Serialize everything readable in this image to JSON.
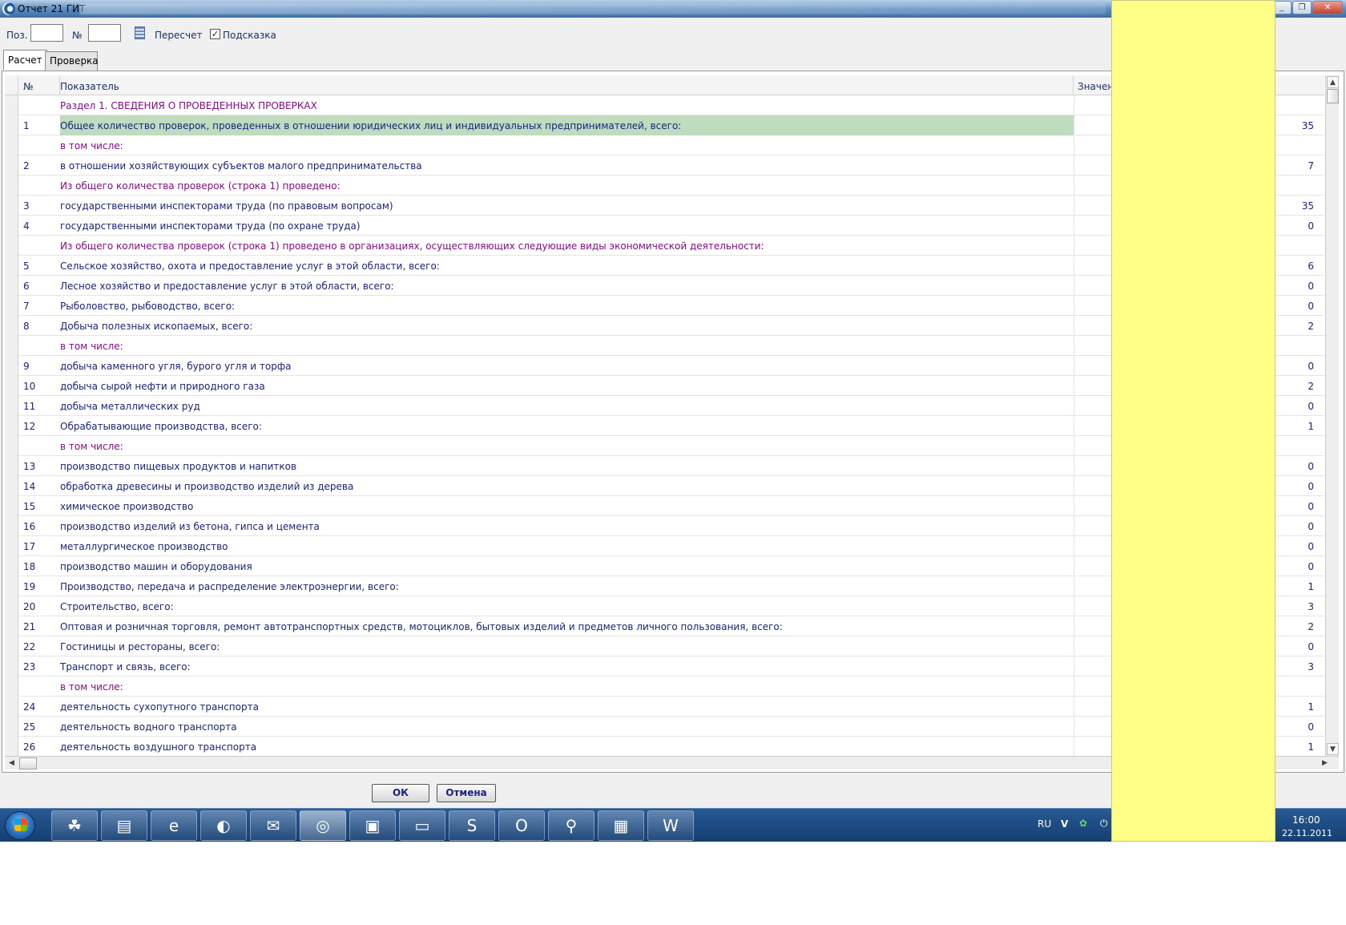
{
  "window": {
    "title": "Отчет 21 ГИТ",
    "controls": [
      "_",
      "❐",
      "✕"
    ]
  },
  "toolbar": {
    "pos_label": "Поз.",
    "pos_value": "",
    "num_label": "№",
    "num_value": "",
    "recalc_label": "Пересчет",
    "hint_label": "Подсказка",
    "hint_checked": true,
    "hint_check_glyph": "✓"
  },
  "tabs": [
    {
      "label": "Расчет",
      "active": true
    },
    {
      "label": "Проверка",
      "active": false
    }
  ],
  "grid": {
    "columns": {
      "num": "№",
      "indicator": "Показатель",
      "value": "Значени"
    },
    "rows": [
      {
        "num": "",
        "text": "Раздел 1. СВЕДЕНИЯ О ПРОВЕДЕННЫХ ПРОВЕРКАХ",
        "value": "",
        "section": true
      },
      {
        "num": "1",
        "text": "Общее количество проверок, проведенных в отношении юридических лиц и индивидуальных предпринимателей, всего:",
        "value": "35",
        "selected": true
      },
      {
        "num": "",
        "text": "в том числе:",
        "value": "",
        "section": true
      },
      {
        "num": "2",
        "text": "в отношении хозяйствующих субъектов малого предпринимательства",
        "value": "7"
      },
      {
        "num": "",
        "text": "Из общего количества проверок (строка 1) проведено:",
        "value": "",
        "section": true
      },
      {
        "num": "3",
        "text": "государственными инспекторами труда (по правовым вопросам)",
        "value": "35"
      },
      {
        "num": "4",
        "text": "государственными инспекторами труда (по охране труда)",
        "value": "0"
      },
      {
        "num": "",
        "text": "Из общего количества проверок (строка 1) проведено в организациях, осуществляющих следующие виды экономической деятельности:",
        "value": "",
        "section": true
      },
      {
        "num": "5",
        "text": "Сельское хозяйство, охота и предоставление услуг в этой области, всего:",
        "value": "6"
      },
      {
        "num": "6",
        "text": "Лесное хозяйство и предоставление услуг в этой области, всего:",
        "value": "0"
      },
      {
        "num": "7",
        "text": "Рыболовство, рыбоводство, всего:",
        "value": "0"
      },
      {
        "num": "8",
        "text": "Добыча полезных ископаемых, всего:",
        "value": "2"
      },
      {
        "num": "",
        "text": "в том числе:",
        "value": "",
        "section": true
      },
      {
        "num": "9",
        "text": "добыча каменного угля, бурого угля и торфа",
        "value": "0"
      },
      {
        "num": "10",
        "text": "добыча сырой нефти и природного газа",
        "value": "2"
      },
      {
        "num": "11",
        "text": "добыча металлических руд",
        "value": "0"
      },
      {
        "num": "12",
        "text": "Обрабатывающие производства, всего:",
        "value": "1"
      },
      {
        "num": "",
        "text": "в том числе:",
        "value": "",
        "section": true
      },
      {
        "num": "13",
        "text": "производство пищевых продуктов и напитков",
        "value": "0"
      },
      {
        "num": "14",
        "text": "обработка древесины и производство изделий из дерева",
        "value": "0"
      },
      {
        "num": "15",
        "text": "химическое производство",
        "value": "0"
      },
      {
        "num": "16",
        "text": "производство изделий из бетона, гипса и цемента",
        "value": "0"
      },
      {
        "num": "17",
        "text": "металлургическое производство",
        "value": "0"
      },
      {
        "num": "18",
        "text": "производство машин и оборудования",
        "value": "0"
      },
      {
        "num": "19",
        "text": "Производство, передача и распределение электроэнергии, всего:",
        "value": "1"
      },
      {
        "num": "20",
        "text": "Строительство, всего:",
        "value": "3"
      },
      {
        "num": "21",
        "text": "Оптовая и розничная торговля, ремонт автотранспортных средств, мотоциклов, бытовых изделий и предметов личного пользования, всего:",
        "value": "2"
      },
      {
        "num": "22",
        "text": "Гостиницы и рестораны, всего:",
        "value": "0"
      },
      {
        "num": "23",
        "text": "Транспорт и связь, всего:",
        "value": "3"
      },
      {
        "num": "",
        "text": "в том числе:",
        "value": "",
        "section": true
      },
      {
        "num": "24",
        "text": "деятельность сухопутного транспорта",
        "value": "1"
      },
      {
        "num": "25",
        "text": "деятельность водного транспорта",
        "value": "0"
      },
      {
        "num": "26",
        "text": "деятельность воздушного транспорта",
        "value": "1"
      }
    ]
  },
  "dialog_buttons": {
    "ok": "ОК",
    "cancel": "Отмена"
  },
  "taskbar": {
    "items": [
      {
        "icon": "clover-icon",
        "glyph": "☘"
      },
      {
        "icon": "folder-icon",
        "glyph": "▤"
      },
      {
        "icon": "internet-explorer-icon",
        "glyph": "e"
      },
      {
        "icon": "globe-app-icon",
        "glyph": "◐"
      },
      {
        "icon": "mail-client-icon",
        "glyph": "✉"
      },
      {
        "icon": "report-app-icon",
        "glyph": "◎",
        "active": true
      },
      {
        "icon": "floppy-disk-icon",
        "glyph": "▣"
      },
      {
        "icon": "sticky-notes-icon",
        "glyph": "▭"
      },
      {
        "icon": "skype-icon",
        "glyph": "S"
      },
      {
        "icon": "opera-icon",
        "glyph": "O"
      },
      {
        "icon": "search-tool-icon",
        "glyph": "⚲"
      },
      {
        "icon": "tax-app-icon",
        "glyph": "▦"
      },
      {
        "icon": "word-icon",
        "glyph": "W"
      }
    ],
    "language": "RU",
    "time": "16:00",
    "date": "22.11.2011"
  }
}
